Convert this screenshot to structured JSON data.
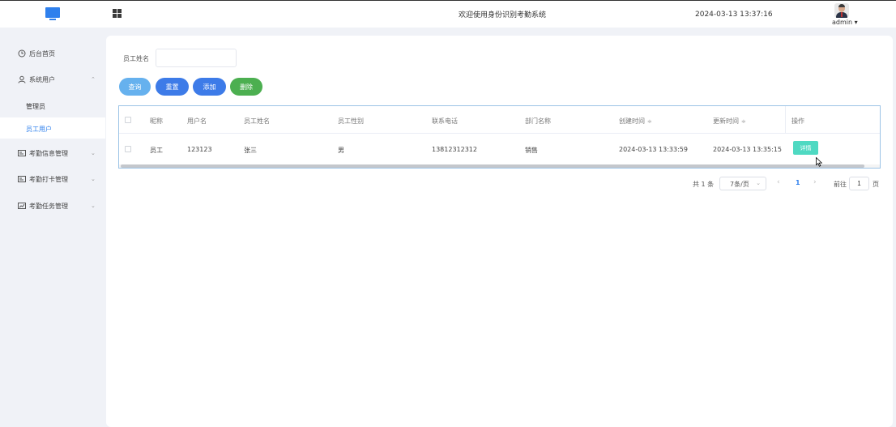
{
  "header": {
    "title": "欢迎使用身份识别考勤系统",
    "datetime": "2024-03-13 13:37:16",
    "user": "admin ▾",
    "logo_icon": "monitor-icon",
    "menu_icon": "grid-icon"
  },
  "sidebar": {
    "items": [
      {
        "label": "后台首页",
        "icon": "clock-icon"
      },
      {
        "label": "系统用户",
        "icon": "user-icon",
        "arrow": "⌃"
      },
      {
        "label": "考勤信息管理",
        "icon": "id-card-icon",
        "arrow": "⌄"
      },
      {
        "label": "考勤打卡管理",
        "icon": "id-card-icon",
        "arrow": "⌄"
      },
      {
        "label": "考勤任务管理",
        "icon": "chart-icon",
        "arrow": "⌄"
      }
    ],
    "subitems": [
      {
        "label": "管理员"
      },
      {
        "label": "员工用户"
      }
    ]
  },
  "search": {
    "label": "员工姓名",
    "value": "",
    "placeholder": ""
  },
  "buttons": {
    "query": "查询",
    "reset": "重置",
    "add": "添加",
    "delete": "删除"
  },
  "table": {
    "columns": [
      "昵称",
      "用户名",
      "员工姓名",
      "员工性别",
      "联系电话",
      "部门名称",
      "创建时间",
      "更新时间",
      "操作"
    ],
    "rows": [
      {
        "nickname": "员工",
        "username": "123123",
        "name": "张三",
        "gender": "男",
        "phone": "13812312312",
        "department": "销售",
        "created": "2024-03-13 13:33:59",
        "updated": "2024-03-13 13:35:15",
        "action": "详情"
      }
    ],
    "sort_glyph": "≑"
  },
  "pagination": {
    "total": "共 1 条",
    "page_size": "7条/页",
    "prev": "‹",
    "current": "1",
    "next": "›",
    "goto_label": "前往",
    "goto_value": "1",
    "page_suffix": "页"
  },
  "colors": {
    "accent": "#2f80ed",
    "query": "#66b1ee",
    "primary": "#3d7be8",
    "delete": "#4caf50",
    "detail": "#4fd9c2"
  }
}
